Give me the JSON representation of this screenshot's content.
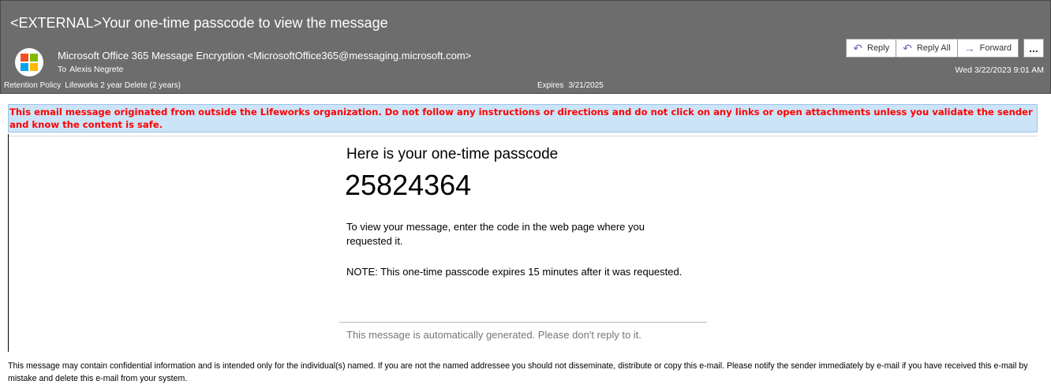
{
  "header": {
    "subject": "<EXTERNAL>Your one-time passcode to view the message",
    "sender": "Microsoft Office 365 Message Encryption <MicrosoftOffice365@messaging.microsoft.com>",
    "to_label": "To",
    "to_value": "Alexis Negrete",
    "retention_label": "Retention Policy",
    "retention_value": "Lifeworks 2 year Delete (2 years)",
    "expires_label": "Expires",
    "expires_value": "3/21/2025",
    "date": "Wed 3/22/2023 9:01 AM",
    "logo_colors": [
      "#f25022",
      "#7fba00",
      "#00a4ef",
      "#ffb900"
    ],
    "actions": {
      "reply": "Reply",
      "reply_all": "Reply All",
      "forward": "Forward",
      "more": "..."
    }
  },
  "banner": {
    "text": "This email message originated from outside the Lifeworks organization. Do not follow any instructions or directions and do not click on any links or open attachments unless you validate the sender and know the content is safe."
  },
  "message": {
    "title": "Here is your one-time passcode",
    "code": "25824364",
    "instructions": "To view your message, enter the code in the web page where you requested it.",
    "note": "NOTE: This one-time passcode expires 15 minutes after it was requested.",
    "auto_generated": "This message is automatically generated. Please don't reply to it."
  },
  "footer": {
    "disclaimer": "This message may contain confidential information and is intended only for the individual(s) named. If you are not the named addressee you should not disseminate, distribute or copy this e-mail. Please notify the sender immediately by e-mail if you have received this e-mail by mistake and delete this e-mail from your system."
  }
}
